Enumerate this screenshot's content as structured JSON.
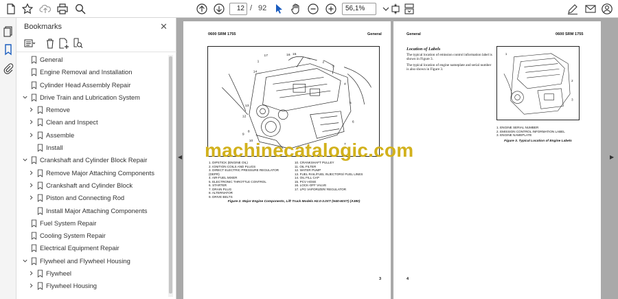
{
  "toolbar": {
    "page_current": "12",
    "page_separator": "/",
    "page_total": "92",
    "zoom": "56,1%"
  },
  "bookmarks": {
    "title": "Bookmarks",
    "close": "✕",
    "items": [
      {
        "label": "General",
        "level": 0,
        "expand": "none"
      },
      {
        "label": "Engine Removal and Installation",
        "level": 0,
        "expand": "none"
      },
      {
        "label": "Cylinder Head Assembly Repair",
        "level": 0,
        "expand": "none"
      },
      {
        "label": "Drive Train and Lubrication System",
        "level": 0,
        "expand": "open"
      },
      {
        "label": "Remove",
        "level": 1,
        "expand": "closed"
      },
      {
        "label": "Clean and Inspect",
        "level": 1,
        "expand": "closed"
      },
      {
        "label": "Assemble",
        "level": 1,
        "expand": "closed"
      },
      {
        "label": "Install",
        "level": 1,
        "expand": "none"
      },
      {
        "label": "Crankshaft and Cylinder Block Repair",
        "level": 0,
        "expand": "open"
      },
      {
        "label": "Remove Major Attaching Components",
        "level": 1,
        "expand": "closed"
      },
      {
        "label": "Crankshaft and Cylinder Block",
        "level": 1,
        "expand": "closed"
      },
      {
        "label": "Piston and Connecting Rod",
        "level": 1,
        "expand": "closed"
      },
      {
        "label": "Install Major Attaching Components",
        "level": 1,
        "expand": "none"
      },
      {
        "label": "Fuel System Repair",
        "level": 0,
        "expand": "none"
      },
      {
        "label": "Cooling System Repair",
        "level": 0,
        "expand": "none"
      },
      {
        "label": "Electrical Equipment Repair",
        "level": 0,
        "expand": "none"
      },
      {
        "label": "Flywheel and Flywheel Housing",
        "level": 0,
        "expand": "open"
      },
      {
        "label": "Flywheel",
        "level": 1,
        "expand": "closed"
      },
      {
        "label": "Flywheel Housing",
        "level": 1,
        "expand": "closed"
      }
    ]
  },
  "left_page": {
    "header_left": "0600 SRM 1755",
    "header_right": "General",
    "legend_col1": [
      "1.  DIPSTICK (ENGINE OIL)",
      "2.  IGNITION COILS AND PLUGS",
      "3.  DIRECT ELECTRIC PRESSURE REGULATOR",
      "     (DEPR)",
      "4.  AIR-FUEL MIXER",
      "5.  ELECTRONIC THROTTLE CONTROL",
      "6.  STARTER",
      "7.  DRAIN PLUG",
      "8.  ALTERNATOR",
      "9.  DRIVE BELTS"
    ],
    "legend_col2": [
      "10. CRANKSHAFT PULLEY",
      "11. OIL FILTER",
      "12. WATER PUMP",
      "13. FUEL RAIL/FUEL INJECTORS/ FUEL LINES",
      "14. OIL FILL CAP",
      "15. PCV HOSE",
      "16. LOCK-OFF VALVE",
      "17. LPG VAPORIZER/ REGULATOR"
    ],
    "caption": "Figure 2. Major Engine Components, Lift Truck Models H2.0-3.0XT (H40-60XT) (A380)",
    "page_number": "3"
  },
  "right_page": {
    "header_left": "General",
    "header_right": "0600 SRM 1755",
    "section_title": "Location of Labels",
    "para1": "The typical location of emission control information label is shown in Figure 3.",
    "para2": "The typical location of engine nameplate and serial number is also shown in Figure 3.",
    "legend": [
      "1.  ENGINE SERIAL NUMBER",
      "2.  EMISSION CONTROL INFORMATION LABEL",
      "3.  ENGINE NAMEPLATE"
    ],
    "caption": "Figure 3. Typical Location of Engine Labels",
    "page_number": "4"
  },
  "watermark": "machinecatalogic.com"
}
